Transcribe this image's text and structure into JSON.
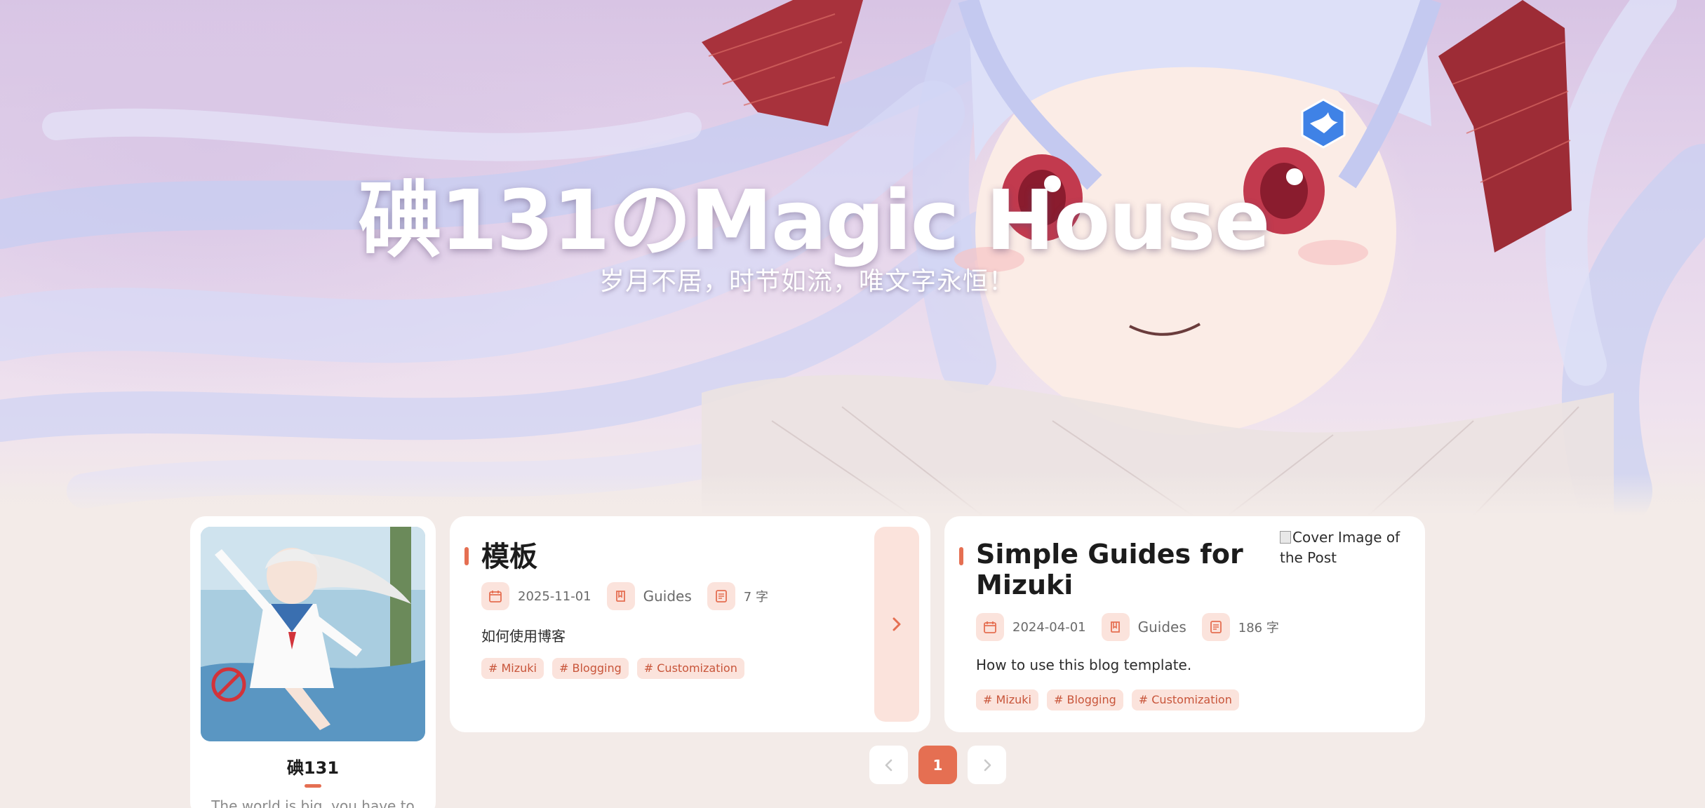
{
  "site": {
    "title": "碘131のMagic House",
    "subtitle": "岁月不居，时节如流，唯文字永恒！"
  },
  "profile": {
    "name": "碘131",
    "bio": "The world is big, you have to"
  },
  "posts": [
    {
      "title": "模板",
      "date": "2025-11-01",
      "category": "Guides",
      "word_count": "7 字",
      "description": "如何使用博客",
      "tags": [
        "# Mizuki",
        "# Blogging",
        "# Customization"
      ]
    },
    {
      "title": "Simple Guides for Mizuki",
      "date": "2024-04-01",
      "category": "Guides",
      "word_count": "186 字",
      "description": "How to use this blog template.",
      "tags": [
        "# Mizuki",
        "# Blogging",
        "# Customization"
      ],
      "cover_alt": "Cover Image of the Post"
    }
  ],
  "pagination": {
    "current_page": "1"
  },
  "colors": {
    "accent": "#e56f52",
    "accent_light": "#fbe3dc",
    "background": "#f3ebe8"
  },
  "icons": {
    "date": "calendar-icon",
    "category": "book-icon",
    "words": "document-icon",
    "enter": "chevron-right-icon",
    "prev": "chevron-left-icon",
    "next": "chevron-right-icon",
    "logo": "bird-hexagon-logo"
  }
}
